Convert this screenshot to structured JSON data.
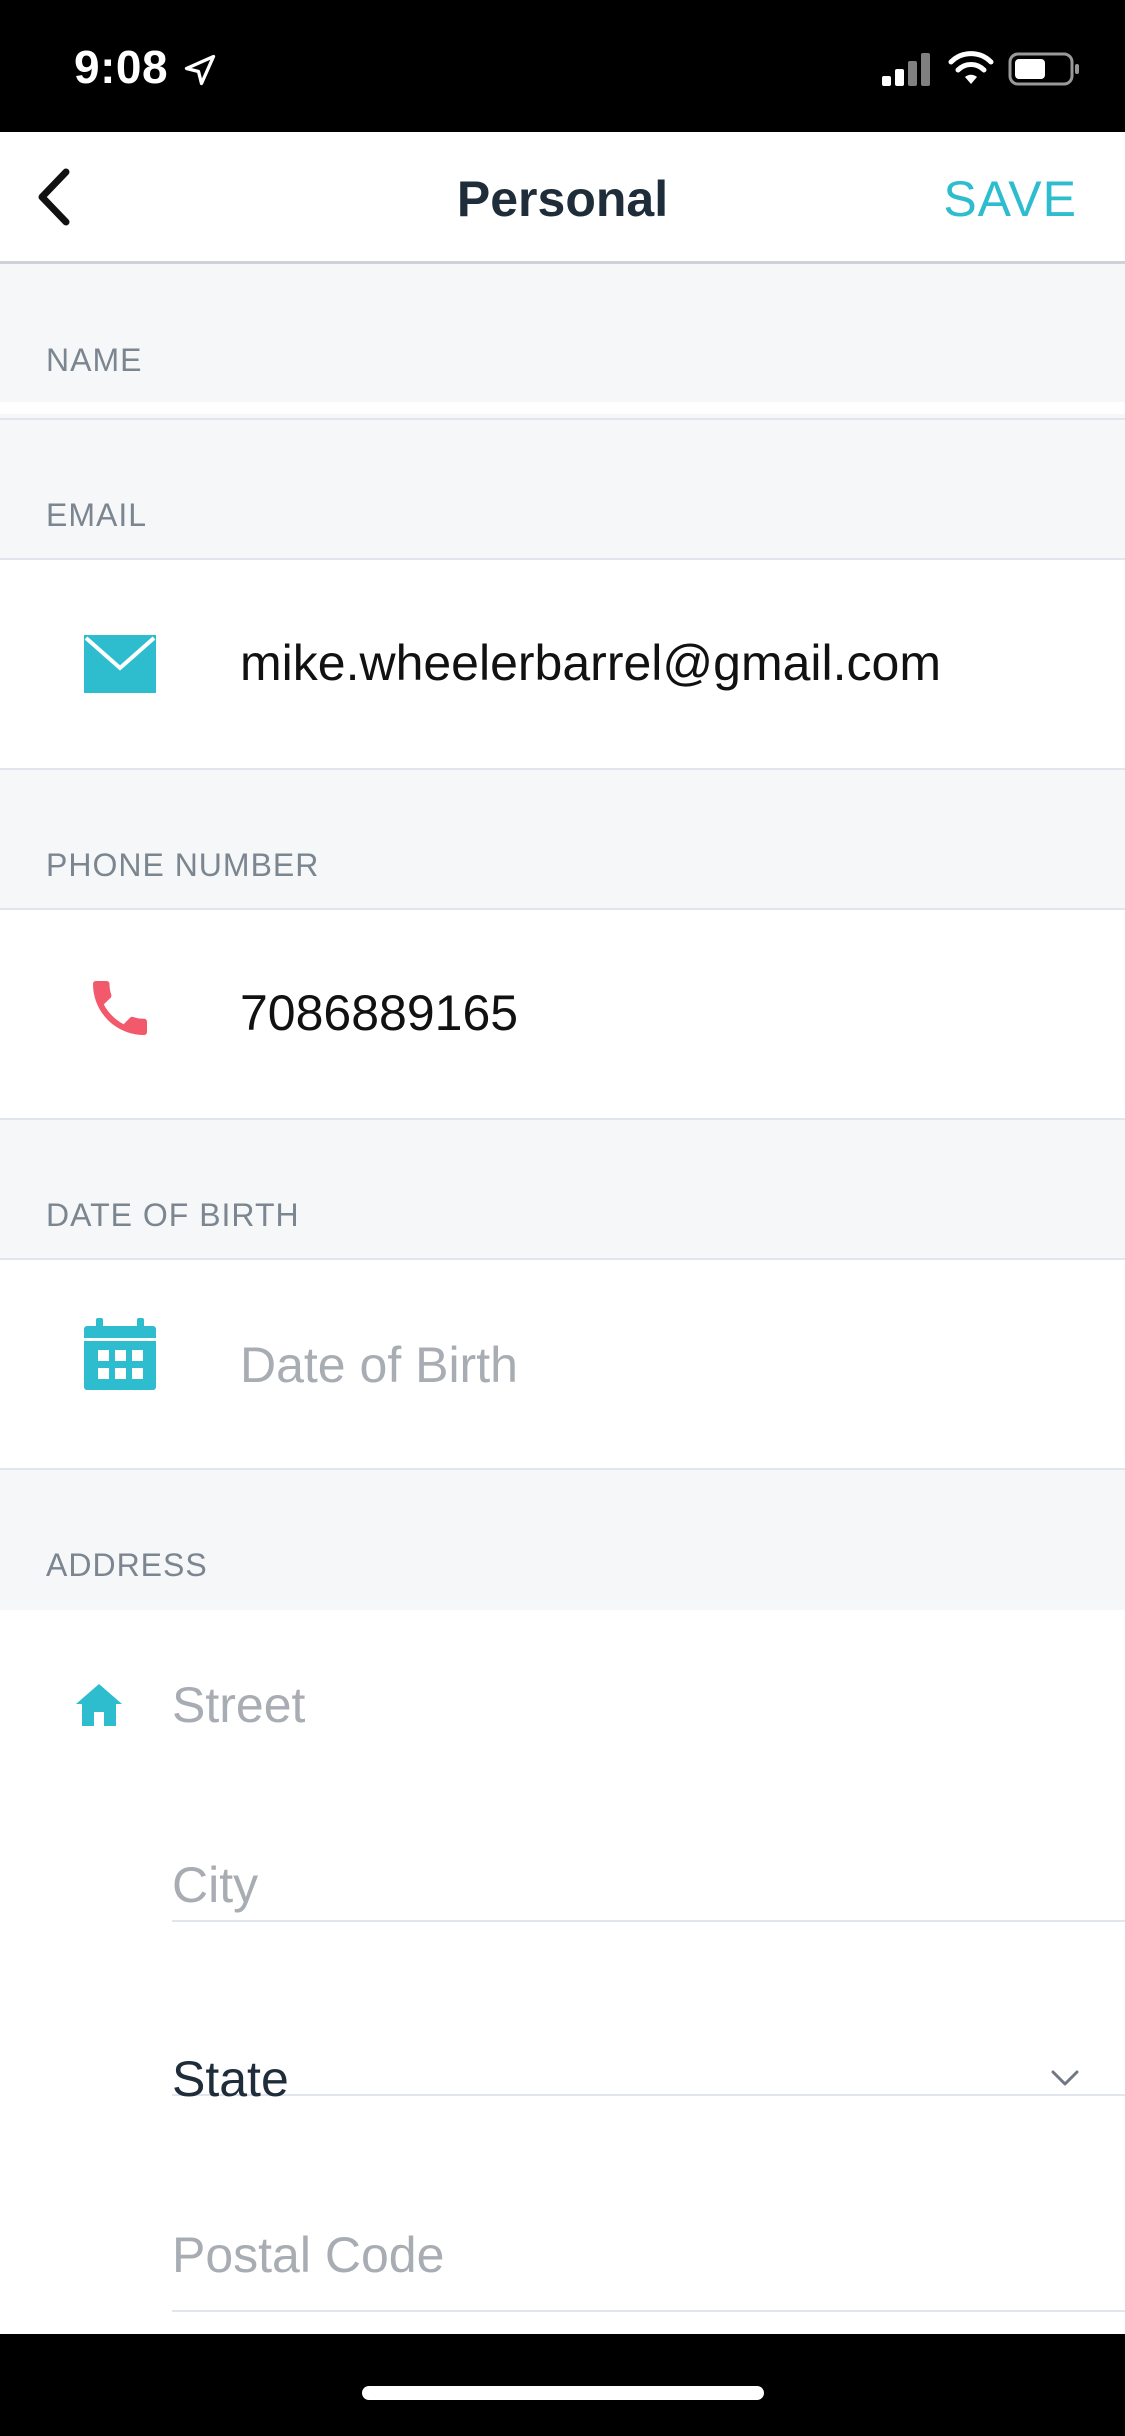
{
  "status_bar": {
    "time": "9:08"
  },
  "nav": {
    "title": "Personal",
    "save_label": "SAVE"
  },
  "sections": {
    "name_label": "NAME",
    "email_label": "EMAIL",
    "phone_label": "PHONE NUMBER",
    "dob_label": "DATE OF BIRTH",
    "address_label": "ADDRESS"
  },
  "fields": {
    "email_value": "mike.wheelerbarrel@gmail.com",
    "phone_value": "7086889165",
    "dob_placeholder": "Date of Birth",
    "street_placeholder": "Street",
    "city_placeholder": "City",
    "state_value": "State",
    "postal_placeholder": "Postal Code"
  },
  "colors": {
    "accent": "#2ebccf",
    "phone_icon": "#f25a6b",
    "section_bg": "#f6f7f9"
  },
  "icons": {
    "email": "mail-icon",
    "phone": "phone-icon",
    "dob": "calendar-icon",
    "address": "home-icon"
  }
}
